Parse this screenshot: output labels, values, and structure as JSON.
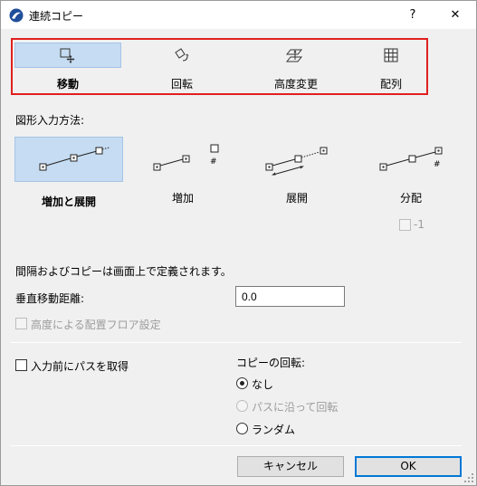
{
  "window": {
    "title": "連続コピー",
    "help_label": "?",
    "close_label": "✕"
  },
  "tabs": [
    {
      "label": "移動",
      "icon": "move-icon",
      "selected": true
    },
    {
      "label": "回転",
      "icon": "rotate-icon",
      "selected": false
    },
    {
      "label": "高度変更",
      "icon": "elevation-icon",
      "selected": false
    },
    {
      "label": "配列",
      "icon": "array-grid-icon",
      "selected": false
    }
  ],
  "input_method": {
    "label": "図形入力方法:",
    "options": [
      {
        "label": "増加と展開",
        "selected": true
      },
      {
        "label": "増加",
        "selected": false
      },
      {
        "label": "展開",
        "selected": false
      },
      {
        "label": "分配",
        "selected": false
      }
    ],
    "increment_marker": "#",
    "distribute_marker": "#",
    "minus_one_label": "-1"
  },
  "info_text": "間隔およびコピーは画面上で定義されます。",
  "vertical_distance": {
    "label": "垂直移動距離:",
    "value": "0.0"
  },
  "floor_placement": {
    "label": "高度による配置フロア設定",
    "enabled": false
  },
  "path_before_input": {
    "label": "入力前にパスを取得",
    "checked": false
  },
  "copy_rotation": {
    "label": "コピーの回転:",
    "options": [
      {
        "label": "なし",
        "checked": true,
        "enabled": true
      },
      {
        "label": "パスに沿って回転",
        "checked": false,
        "enabled": false
      },
      {
        "label": "ランダム",
        "checked": false,
        "enabled": true
      }
    ]
  },
  "buttons": {
    "cancel": "キャンセル",
    "ok": "OK"
  },
  "colors": {
    "highlight_border": "#e02020",
    "selected_bg": "#c5dcf2",
    "primary_border": "#0078d7"
  }
}
